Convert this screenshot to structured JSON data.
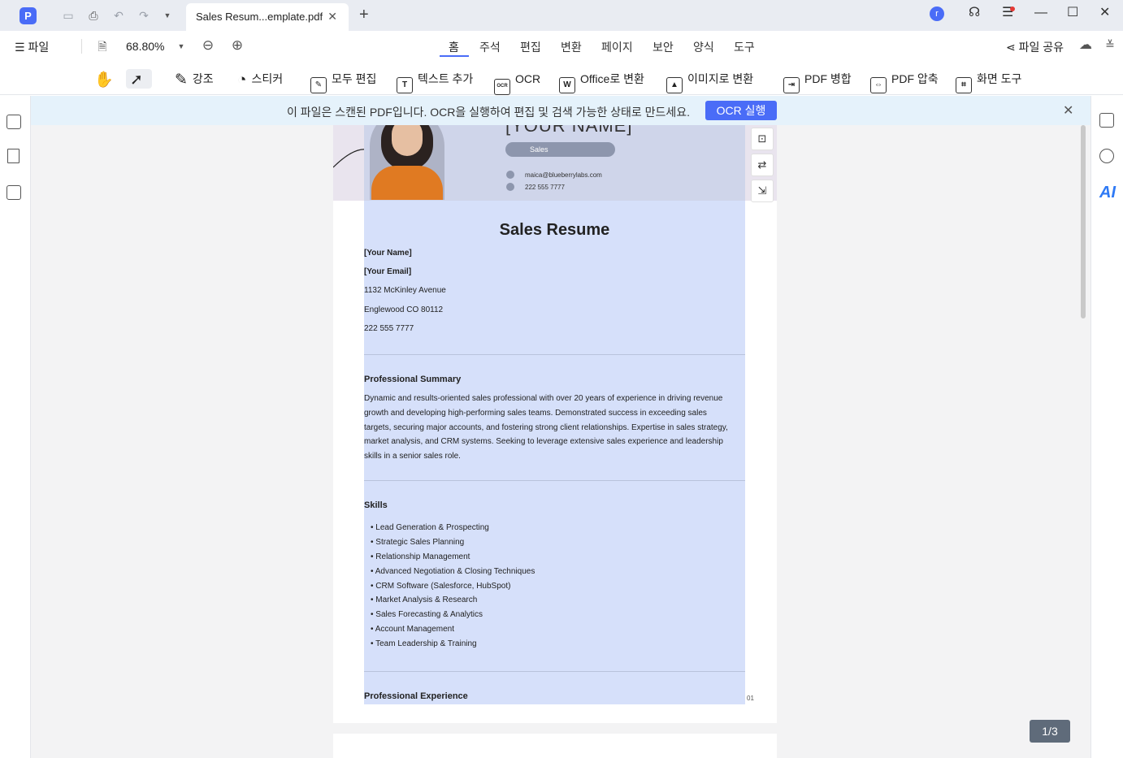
{
  "titlebar": {
    "app_logo": "P",
    "tab_title": "Sales Resum...emplate.pdf",
    "avatar_letter": "r",
    "icons": [
      "save-icon",
      "print-icon",
      "undo-icon",
      "redo-icon",
      "dropdown-icon",
      "close-icon",
      "add-tab-icon",
      "headset-icon",
      "menu-icon",
      "minimize-icon",
      "maximize-icon",
      "close-window-icon"
    ]
  },
  "menubar": {
    "file_label": "파일",
    "zoom": "68.80%",
    "tabs": [
      "홈",
      "주석",
      "편집",
      "변환",
      "페이지",
      "보안",
      "양식",
      "도구"
    ],
    "active_tab": "홈",
    "share_label": "파일 공유"
  },
  "toolbar": {
    "highlight": "강조",
    "sticker": "스티커",
    "edit_all": "모두 편집",
    "add_text": "텍스트 추가",
    "ocr": "OCR",
    "to_office": "Office로 변환",
    "to_image": "이미지로 변환",
    "merge": "PDF 병합",
    "compress": "PDF 압축",
    "screen_tool": "화면 도구",
    "ocr_icon_text": "OCR"
  },
  "banner": {
    "text": "이 파일은 스캔된 PDF입니다. OCR을 실행하여 편집 및 검색 가능한 상태로 만드세요.",
    "button": "OCR 실행"
  },
  "document": {
    "header_name": "[YOUR NAME]",
    "header_role": "Sales",
    "header_email": "maica@blueberrylabs.com",
    "header_phone": "222 555 7777",
    "title": "Sales Resume",
    "your_name": "[Your Name]",
    "your_email": "[Your Email]",
    "address1": "1132 McKinley Avenue",
    "address2": "Englewood CO 80112",
    "phone": "222 555 7777",
    "summary_heading": "Professional Summary",
    "summary_text": "Dynamic and results-oriented sales professional with over 20 years of experience in driving revenue growth and developing high-performing sales teams. Demonstrated success in exceeding sales targets, securing major accounts, and fostering strong client relationships. Expertise in sales strategy, market analysis, and CRM systems. Seeking to leverage extensive sales experience and leadership skills in a senior sales role.",
    "skills_heading": "Skills",
    "skills": [
      "• Lead Generation & Prospecting",
      "• Strategic Sales Planning",
      "• Relationship Management",
      "• Advanced Negotiation & Closing Techniques",
      "• CRM Software (Salesforce, HubSpot)",
      "• Market Analysis & Research",
      "• Sales Forecasting & Analytics",
      "• Account Management",
      "• Team Leadership & Training"
    ],
    "experience_heading": "Professional Experience",
    "page_number": "01"
  },
  "rightbar": {
    "ai_label": "AI"
  },
  "page_indicator": "1/3"
}
